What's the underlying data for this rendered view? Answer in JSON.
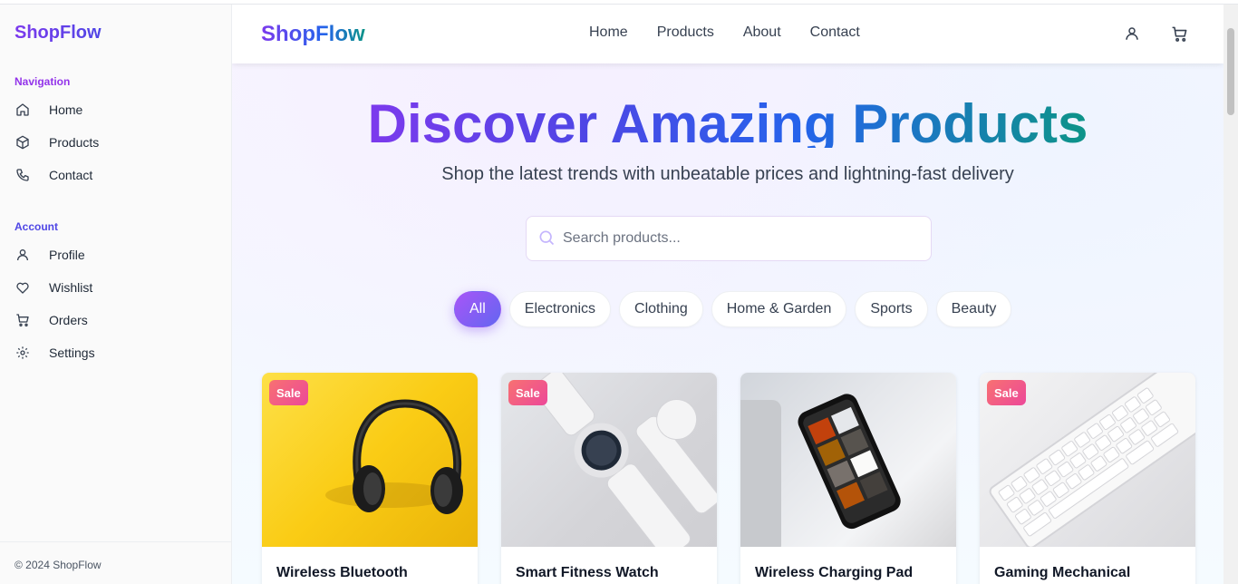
{
  "sidebar": {
    "brand": "ShopFlow",
    "navigation_title": "Navigation",
    "navigation": [
      {
        "label": "Home",
        "icon": "home-icon"
      },
      {
        "label": "Products",
        "icon": "package-icon"
      },
      {
        "label": "Contact",
        "icon": "phone-icon"
      }
    ],
    "account_title": "Account",
    "account": [
      {
        "label": "Profile",
        "icon": "user-icon"
      },
      {
        "label": "Wishlist",
        "icon": "heart-icon"
      },
      {
        "label": "Orders",
        "icon": "cart-icon"
      },
      {
        "label": "Settings",
        "icon": "gear-icon"
      }
    ],
    "footer": "© 2024 ShopFlow"
  },
  "header": {
    "brand": "ShopFlow",
    "nav": [
      "Home",
      "Products",
      "About",
      "Contact"
    ],
    "icons": [
      "user-icon",
      "cart-icon"
    ]
  },
  "hero": {
    "title": "Discover Amazing Products",
    "subtitle": "Shop the latest trends with unbeatable prices and lightning-fast delivery"
  },
  "search": {
    "placeholder": "Search products...",
    "value": ""
  },
  "categories": {
    "items": [
      "All",
      "Electronics",
      "Clothing",
      "Home & Garden",
      "Sports",
      "Beauty"
    ],
    "selected": "All"
  },
  "products": [
    {
      "name": "Wireless Bluetooth",
      "badge": "Sale",
      "image": "headphones"
    },
    {
      "name": "Smart Fitness Watch",
      "badge": "Sale",
      "image": "smartwatch"
    },
    {
      "name": "Wireless Charging Pad",
      "badge": "",
      "image": "smartphone"
    },
    {
      "name": "Gaming Mechanical",
      "badge": "Sale",
      "image": "keyboard"
    }
  ],
  "colors": {
    "accent_purple": "#7c3aed",
    "accent_blue": "#2563eb",
    "accent_teal": "#0d9488",
    "sale_badge": "#f87171"
  }
}
